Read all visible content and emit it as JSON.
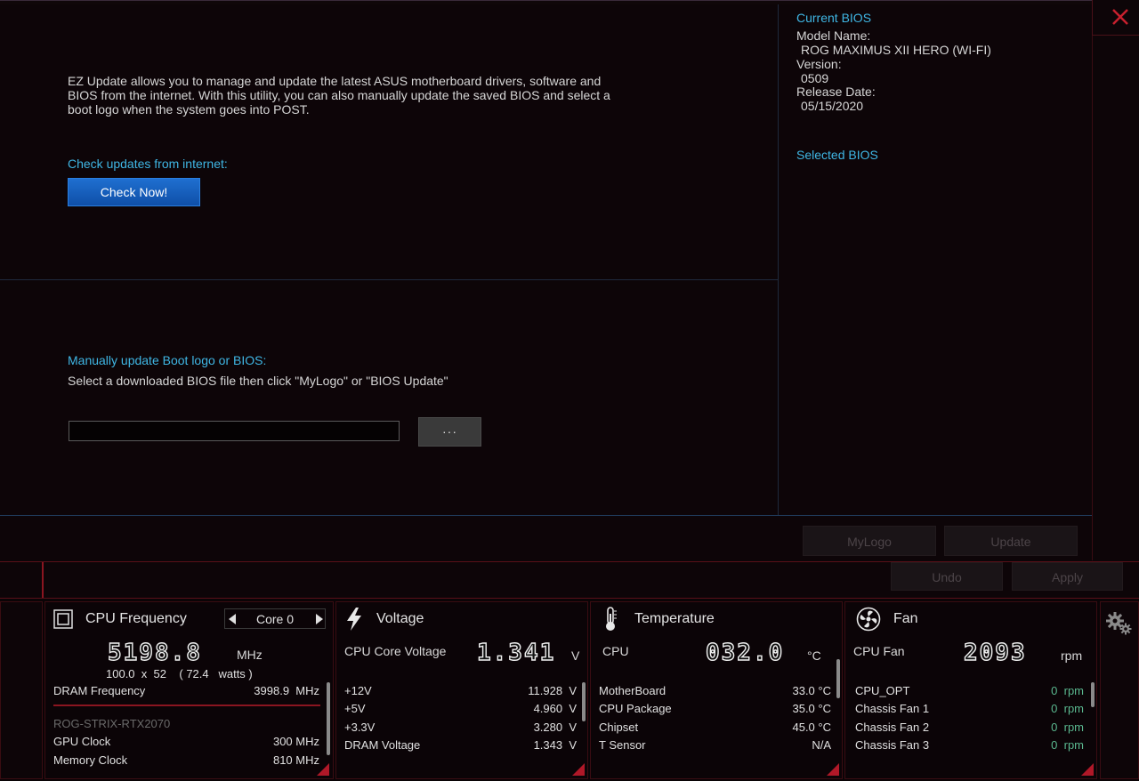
{
  "ez_update": {
    "description": "EZ Update allows you to manage and update the latest ASUS motherboard drivers, software and BIOS from the internet. With this utility, you can also manually update the saved BIOS and select a boot logo when the system goes into POST.",
    "check_heading": "Check updates from internet:",
    "check_button": "Check Now!",
    "manual_heading": "Manually update Boot logo or BIOS:",
    "manual_instruction": "Select a downloaded BIOS file then click \"MyLogo\" or \"BIOS Update\"",
    "file_path_value": "",
    "browse_button": "···"
  },
  "bios_info": {
    "current_heading": "Current BIOS",
    "model_label": "Model Name:",
    "model_value": "ROG MAXIMUS XII HERO (WI-FI)",
    "version_label": "Version:",
    "version_value": "0509",
    "release_label": "Release Date:",
    "release_value": "05/15/2020",
    "selected_heading": "Selected BIOS"
  },
  "actions": {
    "mylogo": "MyLogo",
    "update": "Update",
    "undo": "Undo",
    "apply": "Apply"
  },
  "monitor": {
    "cpu": {
      "title": "CPU Frequency",
      "core_selector": "Core 0",
      "freq_value": "5198.8",
      "freq_unit": "MHz",
      "multiplier_line": "100.0  x  52    ( 72.4   watts )",
      "rows": [
        {
          "label": "DRAM Frequency",
          "value": "3998.9  MHz"
        }
      ],
      "gpu_name": "ROG-STRIX-RTX2070",
      "gpu_rows": [
        {
          "label": "GPU Clock",
          "value": "300 MHz"
        },
        {
          "label": "Memory Clock",
          "value": "810 MHz"
        }
      ]
    },
    "voltage": {
      "title": "Voltage",
      "main_label": "CPU Core Voltage",
      "main_value": "1.341",
      "main_unit": "V",
      "rows": [
        {
          "label": "+12V",
          "value": "11.928  V"
        },
        {
          "label": "+5V",
          "value": "4.960  V"
        },
        {
          "label": "+3.3V",
          "value": "3.280  V"
        },
        {
          "label": "DRAM Voltage",
          "value": "1.343  V"
        }
      ]
    },
    "temperature": {
      "title": "Temperature",
      "main_label": "CPU",
      "main_value": "032.0",
      "main_unit": "°C",
      "rows": [
        {
          "label": "MotherBoard",
          "value": "33.0 °C"
        },
        {
          "label": "CPU Package",
          "value": "35.0 °C"
        },
        {
          "label": "Chipset",
          "value": "45.0 °C"
        },
        {
          "label": "T Sensor",
          "value": "N/A"
        }
      ]
    },
    "fan": {
      "title": "Fan",
      "main_label": "CPU Fan",
      "main_value": "2093",
      "main_unit": "rpm",
      "rows": [
        {
          "label": "CPU_OPT",
          "value": "0  rpm"
        },
        {
          "label": "Chassis Fan 1",
          "value": "0  rpm"
        },
        {
          "label": "Chassis Fan 2",
          "value": "0  rpm"
        },
        {
          "label": "Chassis Fan 3",
          "value": "0  rpm"
        }
      ]
    }
  },
  "colors": {
    "accent_cyan": "#3fb6e4",
    "button_blue": "#1f6fd0",
    "rog_red": "#b01828",
    "fan_green": "#5ab88f"
  }
}
